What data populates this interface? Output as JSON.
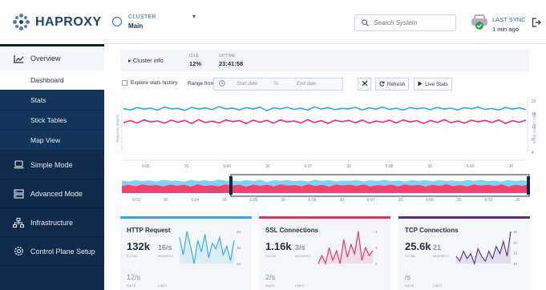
{
  "brand": {
    "name": "HAPROXY"
  },
  "sidebar": {
    "items": [
      {
        "label": "Overview",
        "icon": "line-chart-icon"
      },
      {
        "label": "Simple Mode",
        "icon": "laptop-icon"
      },
      {
        "label": "Advanced Mode",
        "icon": "server-icon"
      },
      {
        "label": "Infrastructure",
        "icon": "network-icon"
      },
      {
        "label": "Control Plane Setup",
        "icon": "gear-icon"
      }
    ],
    "subitems": [
      {
        "label": "Dashboard"
      },
      {
        "label": "Stats"
      },
      {
        "label": "Stick Tables"
      },
      {
        "label": "Map View"
      }
    ]
  },
  "header": {
    "cluster_label": "CLUSTER",
    "cluster_value": "Main",
    "search_placeholder": "Search System",
    "last_sync_label": "LAST SYNC",
    "last_sync_value": "1 min ago"
  },
  "info": {
    "toggle": "Cluster info",
    "idle_label": "IDLE",
    "idle_value": "12%",
    "uptime_label": "UPTIME",
    "uptime_value": "23:41:58"
  },
  "controls": {
    "explore_label": "Explore stats history",
    "range_label": "Range from:",
    "start_placeholder": "Start date",
    "to_label": "To",
    "end_placeholder": "End date",
    "refresh_label": "Refresh",
    "live_label": "Live Stats"
  },
  "colors": {
    "blue": "#29a9e8",
    "pink": "#ee2d5f",
    "purple": "#5c2b82",
    "nav": "#0f2a4a"
  },
  "chart_data": {
    "type": "line",
    "ylabel_left": "Requests (reqs/s)",
    "ylabel_right": "Data transfer (kB/s)",
    "x_ticks": [
      "6:05",
      "30",
      "6:06",
      "30",
      "6:07",
      "30",
      "6:08",
      "30",
      "6:09",
      "30"
    ],
    "right_ticks": [
      "20",
      "16",
      "12",
      "8",
      "4"
    ],
    "series": [
      {
        "values": [
          17,
          16.5,
          17.4,
          16.8,
          17.2,
          16.4,
          17.6,
          16.9,
          17.1,
          16.3,
          17.5,
          16.8,
          17.3,
          16.6,
          17.8,
          16.9,
          17.2,
          16.5,
          17.4,
          16.8,
          17.6,
          16.2,
          17.3,
          16.9,
          17.5,
          16.7,
          17.2,
          16.4,
          17.7,
          16.8,
          17.4,
          16.6,
          17.1,
          16.9,
          17.5,
          16.5,
          17.3,
          16.8,
          17.6,
          16.7,
          17.2,
          16.4,
          17.4,
          16.9,
          17.3,
          16.6,
          17.5,
          16.8,
          17.2,
          16.5,
          17.4,
          16.9,
          17.6,
          16.7,
          17.1,
          16.4,
          17.5,
          16.8,
          17.3,
          16.6
        ]
      },
      {
        "values": [
          11.5,
          12.3,
          11.4,
          12.6,
          11.8,
          12.2,
          11.3,
          12.5,
          11.7,
          12.4,
          11.2,
          12.7,
          11.6,
          12.1,
          11.4,
          12.6,
          11.9,
          12.3,
          11.2,
          12.5,
          11.7,
          12.4,
          11.3,
          12.6,
          11.8,
          12.2,
          11.4,
          12.7,
          11.6,
          12.3,
          11.2,
          12.5,
          11.9,
          12.4,
          11.5,
          12.6,
          11.3,
          12.2,
          11.7,
          12.5,
          11.4,
          12.6,
          11.8,
          12.3,
          11.2,
          12.4,
          11.6,
          12.7,
          11.5,
          12.2,
          11.3,
          12.5,
          11.8,
          12.4,
          11.6,
          12.6,
          11.2,
          12.3,
          11.7,
          12.5
        ]
      }
    ],
    "ylim": [
      0,
      20
    ],
    "overview_ticks": [
      "6:03",
      "30",
      "6:04",
      "30",
      "6:05",
      "30",
      "6:06",
      "30",
      "6:07",
      "30",
      "6:08",
      "30",
      "6:09",
      "30"
    ]
  },
  "cards": [
    {
      "title": "HTTP Request",
      "total": "132k",
      "total_label": "TOTAL",
      "rate": "16/s",
      "rate_label": "HIGHEST",
      "rate2": "12/s",
      "rate2_label": "RATE",
      "limit_label": "LIMIT",
      "color": "#29a9e8",
      "spark": [
        20,
        14,
        22,
        17,
        11,
        19,
        15,
        21,
        13,
        18,
        16,
        20,
        14,
        17,
        12,
        19
      ],
      "ticks": [
        "20",
        "16",
        "12"
      ]
    },
    {
      "title": "SSL Connections",
      "total": "1.16k",
      "total_label": "TOTAL",
      "rate": "3/s",
      "rate_label": "HIGHEST",
      "rate2": "2/s",
      "rate2_label": "RATE",
      "limit_label": "LIMIT",
      "color": "#ee2d5f",
      "spark": [
        2,
        2.5,
        2,
        3,
        2.2,
        2.8,
        2,
        3.5,
        2.4,
        3.2,
        2.6,
        4,
        2.2,
        3,
        2.5,
        2.8
      ],
      "ticks": [
        "4",
        "3",
        "2"
      ]
    },
    {
      "title": "TCP Connections",
      "total": "25.6k",
      "total_label": "TOTAL",
      "rate": "21",
      "rate_label": "HIGHEST",
      "rate2": "/s",
      "rate2_label": "RATE",
      "limit_label": "LIMIT",
      "color": "#5c2b82",
      "spark": [
        14,
        12,
        16,
        13,
        15,
        11,
        17,
        14,
        12,
        16,
        13,
        18,
        15,
        20,
        14,
        24
      ],
      "ticks": [
        "25",
        "20",
        "15",
        "10"
      ]
    }
  ]
}
